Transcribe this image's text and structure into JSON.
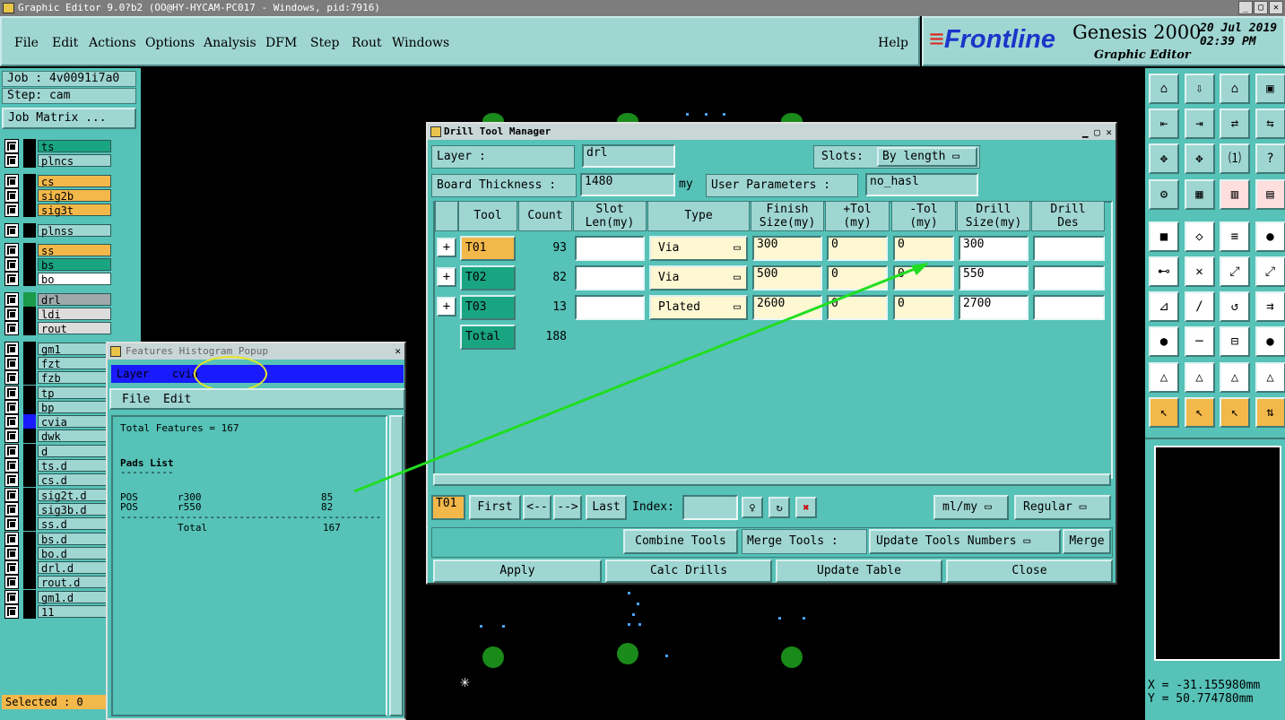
{
  "window": {
    "title": "Graphic Editor 9.0?b2 (OO@HY-HYCAM-PC017 - Windows, pid:7916)",
    "min": "_",
    "max": "▢",
    "close": "✕"
  },
  "menu": {
    "file": "File",
    "edit": "Edit",
    "actions": "Actions",
    "options": "Options",
    "analysis": "Analysis",
    "dfm": "DFM",
    "step": "Step",
    "rout": "Rout",
    "windows": "Windows",
    "help": "Help"
  },
  "brand": {
    "logo": "Frontline",
    "product": "Genesis 2000",
    "subtitle": "Graphic Editor",
    "date": "20 Jul 2019",
    "time": "02:39 PM"
  },
  "left": {
    "job": "Job : 4v0091i7a0",
    "step": "Step: cam",
    "job_matrix": "Job Matrix ...",
    "selected": "Selected : 0",
    "layers": [
      {
        "name": "ts",
        "color": "#1aa582"
      },
      {
        "name": "plncs",
        "color": "#9fd6d2"
      },
      {
        "name": "cs",
        "color": "#f3b84a"
      },
      {
        "name": "sig2b",
        "color": "#f3b84a"
      },
      {
        "name": "sig3t",
        "color": "#f3b84a"
      },
      {
        "name": "plnss",
        "color": "#9fd6d2"
      },
      {
        "name": "ss",
        "color": "#f3b84a"
      },
      {
        "name": "bs",
        "color": "#1aa582"
      },
      {
        "name": "bo",
        "color": "#ffffff"
      },
      {
        "name": "drl",
        "color": "#9fa8aa"
      },
      {
        "name": "ldi",
        "color": "#dddddd"
      },
      {
        "name": "rout",
        "color": "#dddddd"
      },
      {
        "name": "gm1",
        "color": "#9fd6d2"
      },
      {
        "name": "fzt",
        "color": "#9fd6d2"
      },
      {
        "name": "fzb",
        "color": "#9fd6d2"
      },
      {
        "name": "tp",
        "color": "#9fd6d2"
      },
      {
        "name": "bp",
        "color": "#9fd6d2"
      },
      {
        "name": "cvia",
        "color": "#9fd6d2"
      },
      {
        "name": "dwk",
        "color": "#9fd6d2"
      },
      {
        "name": "d",
        "color": "#9fd6d2"
      },
      {
        "name": "ts.d",
        "color": "#9fd6d2"
      },
      {
        "name": "cs.d",
        "color": "#9fd6d2"
      },
      {
        "name": "sig2t.d",
        "color": "#9fd6d2"
      },
      {
        "name": "sig3b.d",
        "color": "#9fd6d2"
      },
      {
        "name": "ss.d",
        "color": "#9fd6d2"
      },
      {
        "name": "bs.d",
        "color": "#9fd6d2"
      },
      {
        "name": "bo.d",
        "color": "#9fd6d2"
      },
      {
        "name": "drl.d",
        "color": "#9fd6d2"
      },
      {
        "name": "rout.d",
        "color": "#9fd6d2"
      },
      {
        "name": "gm1.d",
        "color": "#9fd6d2"
      },
      {
        "name": "11",
        "color": "#9fd6d2"
      }
    ]
  },
  "dtm": {
    "title": "Drill Tool Manager",
    "layer_label": "Layer :",
    "layer": "drl",
    "slots_label": "Slots:",
    "slots": "By length",
    "thick_label": "Board Thickness :",
    "thick": "1480",
    "thick_unit": "my",
    "user_params": "User Parameters :",
    "user_val": "no_hasl",
    "headers": [
      "Tool",
      "Count",
      "Slot Len(my)",
      "Type",
      "Finish Size(my)",
      "+Tol (my)",
      "-Tol (my)",
      "Drill Size(my)",
      "Drill Des"
    ],
    "rows": [
      {
        "tool": "T01",
        "count": "93",
        "slot": "",
        "type": "Via",
        "finish": "300",
        "ptol": "0",
        "mtol": "0",
        "drill": "300",
        "des": ""
      },
      {
        "tool": "T02",
        "count": "82",
        "slot": "",
        "type": "Via",
        "finish": "500",
        "ptol": "0",
        "mtol": "0",
        "drill": "550",
        "des": ""
      },
      {
        "tool": "T03",
        "count": "13",
        "slot": "",
        "type": "Plated",
        "finish": "2600",
        "ptol": "0",
        "mtol": "0",
        "drill": "2700",
        "des": ""
      }
    ],
    "total_label": "Total",
    "total": "188",
    "nav": {
      "cur": "T01",
      "first": "First",
      "prev": "<--",
      "next": "-->",
      "last": "Last",
      "index": "Index:",
      "units": "ml/my",
      "mode": "Regular"
    },
    "combine": "Combine Tools",
    "merge_label": "Merge Tools :",
    "update_nums": "Update Tools Numbers",
    "merge": "Merge",
    "apply": "Apply",
    "calc": "Calc Drills",
    "update_table": "Update Table",
    "close": "Close"
  },
  "pop": {
    "title": "Features Histogram Popup",
    "layer_label": "Layer",
    "layer": "cvia",
    "file": "File",
    "edit": "Edit",
    "total_features": "Total Features = 167",
    "pads_list": "Pads List",
    "underline": "---------",
    "rows": [
      {
        "c1": "POS",
        "c2": "r300",
        "c3": "85"
      },
      {
        "c1": "POS",
        "c2": "r550",
        "c3": "82"
      }
    ],
    "dashes": "--------------------------------------------",
    "total_label": "Total",
    "total": "167"
  },
  "coords": {
    "x": "X = -31.155980mm",
    "y": "Y = 50.774780mm"
  }
}
